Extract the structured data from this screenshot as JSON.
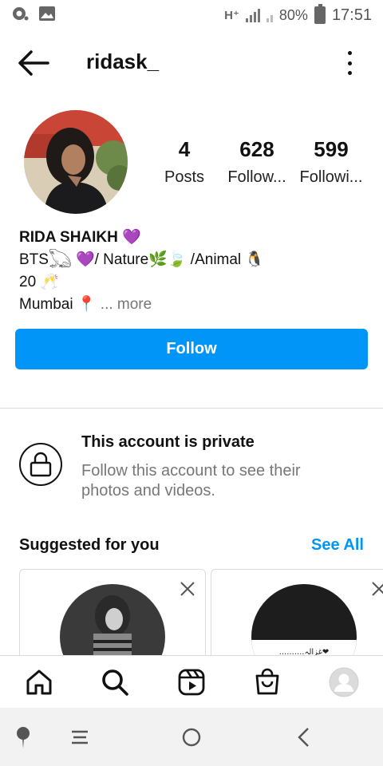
{
  "status_bar": {
    "network": "H⁺",
    "battery": "80%",
    "time": "17:51"
  },
  "header": {
    "username": "ridask_"
  },
  "profile": {
    "posts_count": "4",
    "posts_label": "Posts",
    "followers_count": "628",
    "followers_label": "Follow...",
    "following_count": "599",
    "following_label": "Followi..."
  },
  "bio": {
    "name": "RIDA SHAIKH 💜",
    "line1": "BTS𓆏 💜/ Nature🌿🍃 /Animal 🐧",
    "line2": "20 🥂",
    "line3": "Mumbai 📍",
    "more": "... more"
  },
  "actions": {
    "follow_label": "Follow"
  },
  "private": {
    "title": "This account is private",
    "description": "Follow this account to see their photos and videos."
  },
  "suggested": {
    "title": "Suggested for you",
    "see_all": "See All",
    "card2_caption": "..........غزالہ❤"
  },
  "colors": {
    "accent": "#0095f6",
    "muted_text": "#777777",
    "border": "#dbdbdb"
  },
  "icons": [
    "back-arrow-icon",
    "more-options-icon",
    "lock-icon",
    "close-icon",
    "home-icon",
    "search-icon",
    "reels-icon",
    "shop-icon",
    "profile-avatar-icon"
  ]
}
